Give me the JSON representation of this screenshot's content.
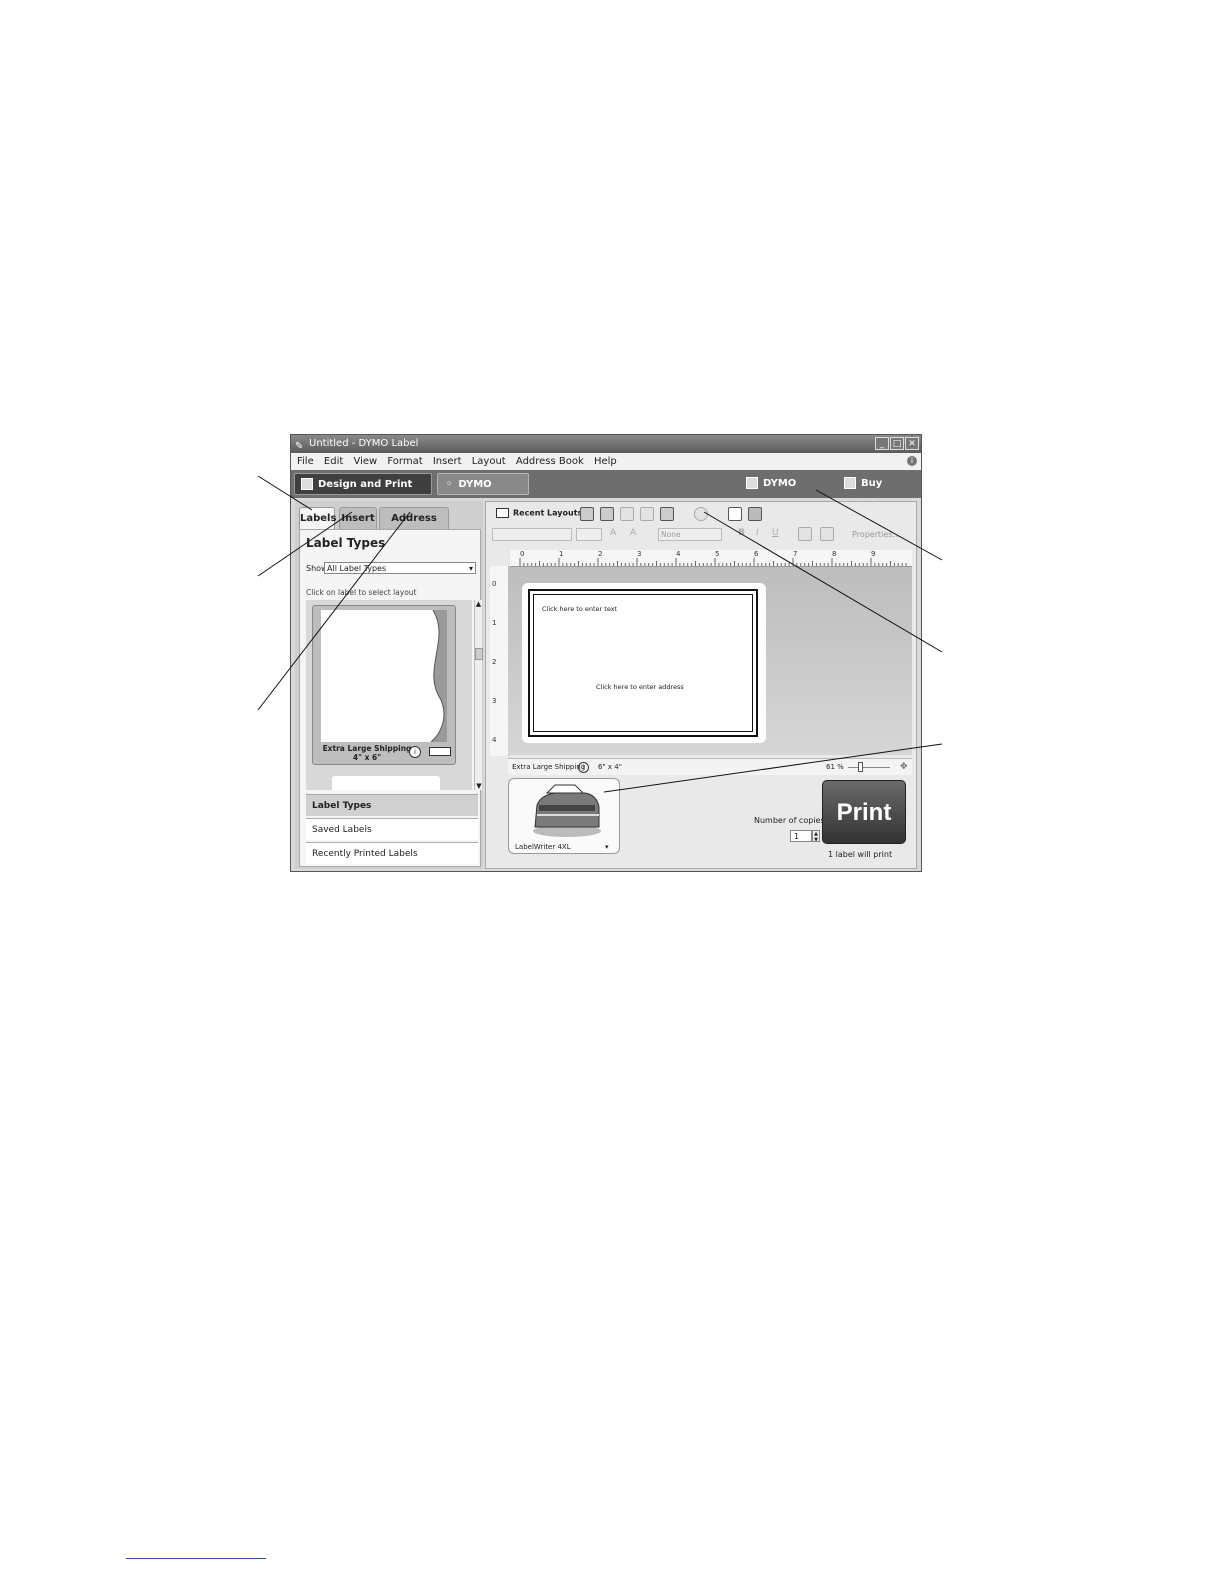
{
  "window": {
    "title": "Untitled - DYMO Label",
    "minimize": "_",
    "maximize": "□",
    "close": "✕"
  },
  "menu": [
    "File",
    "Edit",
    "View",
    "Format",
    "Insert",
    "Layout",
    "Address Book",
    "Help"
  ],
  "nav": {
    "design": "Design and Print Labels",
    "online": "DYMO Online",
    "stamps": "DYMO Stamps",
    "buy": "Buy Labels"
  },
  "left_panel": {
    "tabs": [
      "Labels",
      "Insert",
      "Address Book"
    ],
    "title": "Label Types",
    "show_label": "Show",
    "show_value": "All Label Types",
    "hint": "Click on label to select layout",
    "card_name": "Extra Large Shipping",
    "card_size": "4\" x 6\"",
    "accordion": [
      "Label Types",
      "Saved Labels",
      "Recently Printed Labels"
    ]
  },
  "toolbar": {
    "recent_layouts": "Recent Layouts",
    "font_placeholder": "None",
    "bold": "B",
    "italic": "I",
    "underline": "U",
    "properties": "Properties..."
  },
  "ruler": {
    "h": [
      "0",
      "1",
      "2",
      "3",
      "4",
      "5",
      "6",
      "7",
      "8",
      "9"
    ],
    "v": [
      "0",
      "1",
      "2",
      "3",
      "4"
    ]
  },
  "canvas": {
    "text_placeholder": "Click here to enter text",
    "address_placeholder": "Click here to enter address"
  },
  "status": {
    "label_name": "Extra Large Shipping",
    "size": "6\" x 4\"",
    "zoom": "61 %"
  },
  "printer": {
    "name": "LabelWriter 4XL",
    "copies_label": "Number of copies",
    "copies_value": "1",
    "print": "Print",
    "note": "1 label will print"
  }
}
